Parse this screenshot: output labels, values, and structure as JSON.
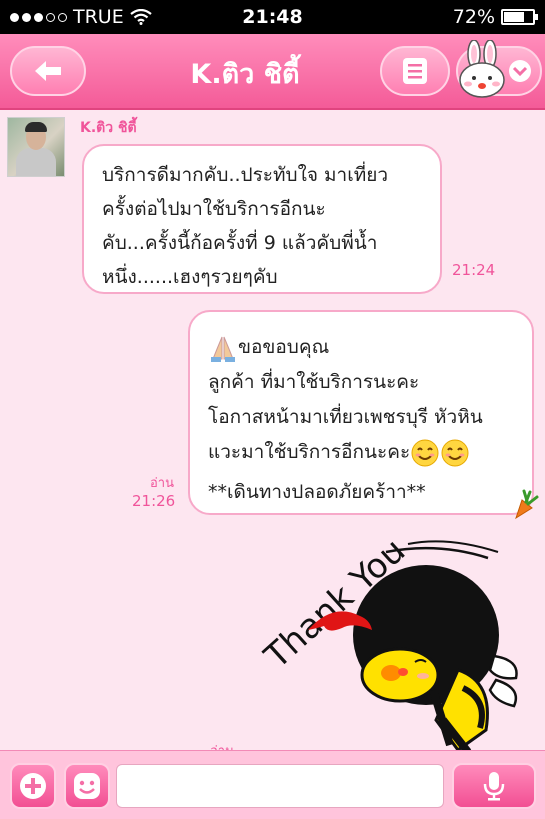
{
  "status_bar": {
    "carrier": "TRUE",
    "time": "21:48",
    "battery": "72%",
    "battery_level": 0.72,
    "signal_dots_filled": 3,
    "signal_dots_total": 5
  },
  "header": {
    "title": "K.ติว ชิตี้",
    "back_icon": "back-arrow-icon",
    "menu_icon": "menu-list-icon",
    "friend_icon": "bunny-chevron-icon"
  },
  "messages": [
    {
      "sender": "K.ติว ชิตี้",
      "lines": [
        "บริการดีมากคับ..ประทับใจ มาเที่ยว",
        "ครั้งต่อไปมาใช้บริการอีกนะ",
        "คับ...ครั้งนี้ก้อครั้งที่ 9 แล้วคับพี่น้ำ",
        "หนึ่ง......เฮงๆรวยๆคับ"
      ],
      "time": "21:24"
    },
    {
      "lines": [
        "ขอขอบคุณ",
        "ลูกค้า ที่มาใช้บริการนะคะ",
        "โอกาสหน้ามาเที่ยวเพชรบุรี หัวหิน",
        "แวะมาใช้บริการอีกนะคะ",
        "**เดินทางปลอดภัยคร้าา**"
      ],
      "read": "อ่าน",
      "time": "21:26"
    },
    {
      "sticker_text": "Thank You",
      "read": "อ่าน"
    }
  ],
  "input_bar": {
    "placeholder": "",
    "plus_icon": "plus-icon",
    "sticker_icon": "smiley-icon",
    "mic_icon": "microphone-icon"
  },
  "colors": {
    "accent": "#f45b98",
    "accent_light": "#ff8dbb",
    "background": "#fde6f0",
    "time_text": "#f0549a"
  }
}
